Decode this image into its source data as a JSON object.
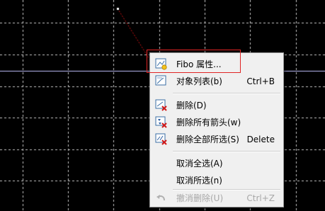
{
  "menu": {
    "items": [
      {
        "label": "Fibo 属性...",
        "shortcut": "",
        "icon": "fibo-properties-icon",
        "disabled": false
      },
      {
        "label": "对象列表(b)",
        "shortcut": "Ctrl+B",
        "icon": "object-list-icon",
        "disabled": false
      },
      {
        "label": "删除(D)",
        "shortcut": "",
        "icon": "delete-icon",
        "disabled": false
      },
      {
        "label": "删除所有箭头(w)",
        "shortcut": "",
        "icon": "delete-arrows-icon",
        "disabled": false
      },
      {
        "label": "删除全部所选(S)",
        "shortcut": "Delete",
        "icon": "delete-selected-icon",
        "disabled": false
      },
      {
        "label": "取消全选(A)",
        "shortcut": "",
        "icon": "",
        "disabled": false
      },
      {
        "label": "取消所选(n)",
        "shortcut": "",
        "icon": "",
        "disabled": false
      },
      {
        "label": "撤消删除(U)",
        "shortcut": "Ctrl+Z",
        "icon": "undo-icon",
        "disabled": true
      }
    ]
  },
  "colors": {
    "chart_background": "#000000",
    "grid": "#c8c8c8",
    "horizontal_line": "#c0c0ff",
    "trend_line": "#d01414",
    "highlight": "#e02424",
    "menu_background": "#f0f0f0"
  }
}
